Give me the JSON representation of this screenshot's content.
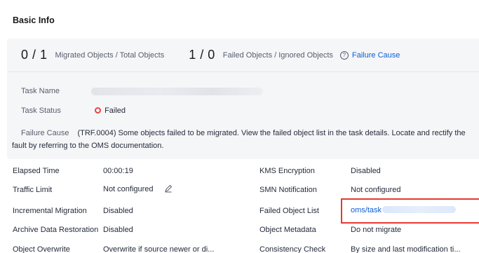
{
  "section": {
    "title": "Basic Info"
  },
  "stats": {
    "migrated_value": "0 / 1",
    "migrated_label": "Migrated Objects / Total Objects",
    "failed_value": "1 / 0",
    "failed_label": "Failed Objects / Ignored Objects",
    "failure_cause_link": "Failure Cause"
  },
  "card": {
    "task_name_label": "Task Name",
    "task_status_label": "Task Status",
    "task_status_value": "Failed",
    "failure_cause_label": "Failure Cause",
    "failure_cause_text": "(TRF.0004) Some objects failed to be migrated. View the failed object list in the task details. Locate and rectify the fault by referring to the OMS documentation."
  },
  "details": {
    "elapsed_time_label": "Elapsed Time",
    "elapsed_time_value": "00:00:19",
    "traffic_limit_label": "Traffic Limit",
    "traffic_limit_value": "Not configured",
    "incremental_label": "Incremental Migration",
    "incremental_value": "Disabled",
    "archive_label": "Archive Data Restoration",
    "archive_value": "Disabled",
    "overwrite_label": "Object Overwrite",
    "overwrite_value": "Overwrite if source newer or di...",
    "kms_label": "KMS Encryption",
    "kms_value": "Disabled",
    "smn_label": "SMN Notification",
    "smn_value": "Not configured",
    "failed_list_label": "Failed Object List",
    "failed_list_value": "oms/task",
    "metadata_label": "Object Metadata",
    "metadata_value": "Do not migrate",
    "consistency_label": "Consistency Check",
    "consistency_value": "By size and last modification ti..."
  },
  "colors": {
    "link": "#0b5dd6",
    "failed": "#e54545",
    "highlight": "#e8382f",
    "card_bg": "#f5f6f8"
  }
}
